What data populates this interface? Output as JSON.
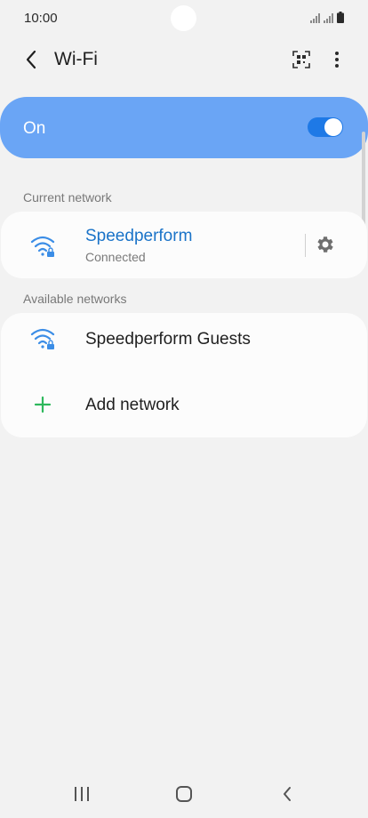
{
  "status_bar": {
    "time": "10:00",
    "icons": [
      "wifi-signal-icon",
      "cellular-signal-icon",
      "battery-icon"
    ]
  },
  "appbar": {
    "title": "Wi-Fi",
    "icons": [
      "back-arrow-icon",
      "qr-code-icon",
      "more-vert-icon"
    ]
  },
  "master_switch": {
    "label": "On",
    "state": true
  },
  "current_network": {
    "section_label": "Current network",
    "name": "Speedperform",
    "status": "Connected",
    "name_color": "#1a73c8"
  },
  "available_networks": {
    "section_label": "Available networks",
    "items": [
      {
        "name": "Speedperform Guests",
        "icon": "wifi-locked-icon"
      }
    ],
    "add_label": "Add network"
  },
  "navbar": {
    "icons": [
      "recent-apps-icon",
      "home-icon",
      "back-icon"
    ]
  },
  "colors": {
    "accent": "#6aa5f5",
    "toggle": "#1e79e6",
    "plus": "#2eb85c",
    "wifi_icon": "#3b8de6"
  }
}
